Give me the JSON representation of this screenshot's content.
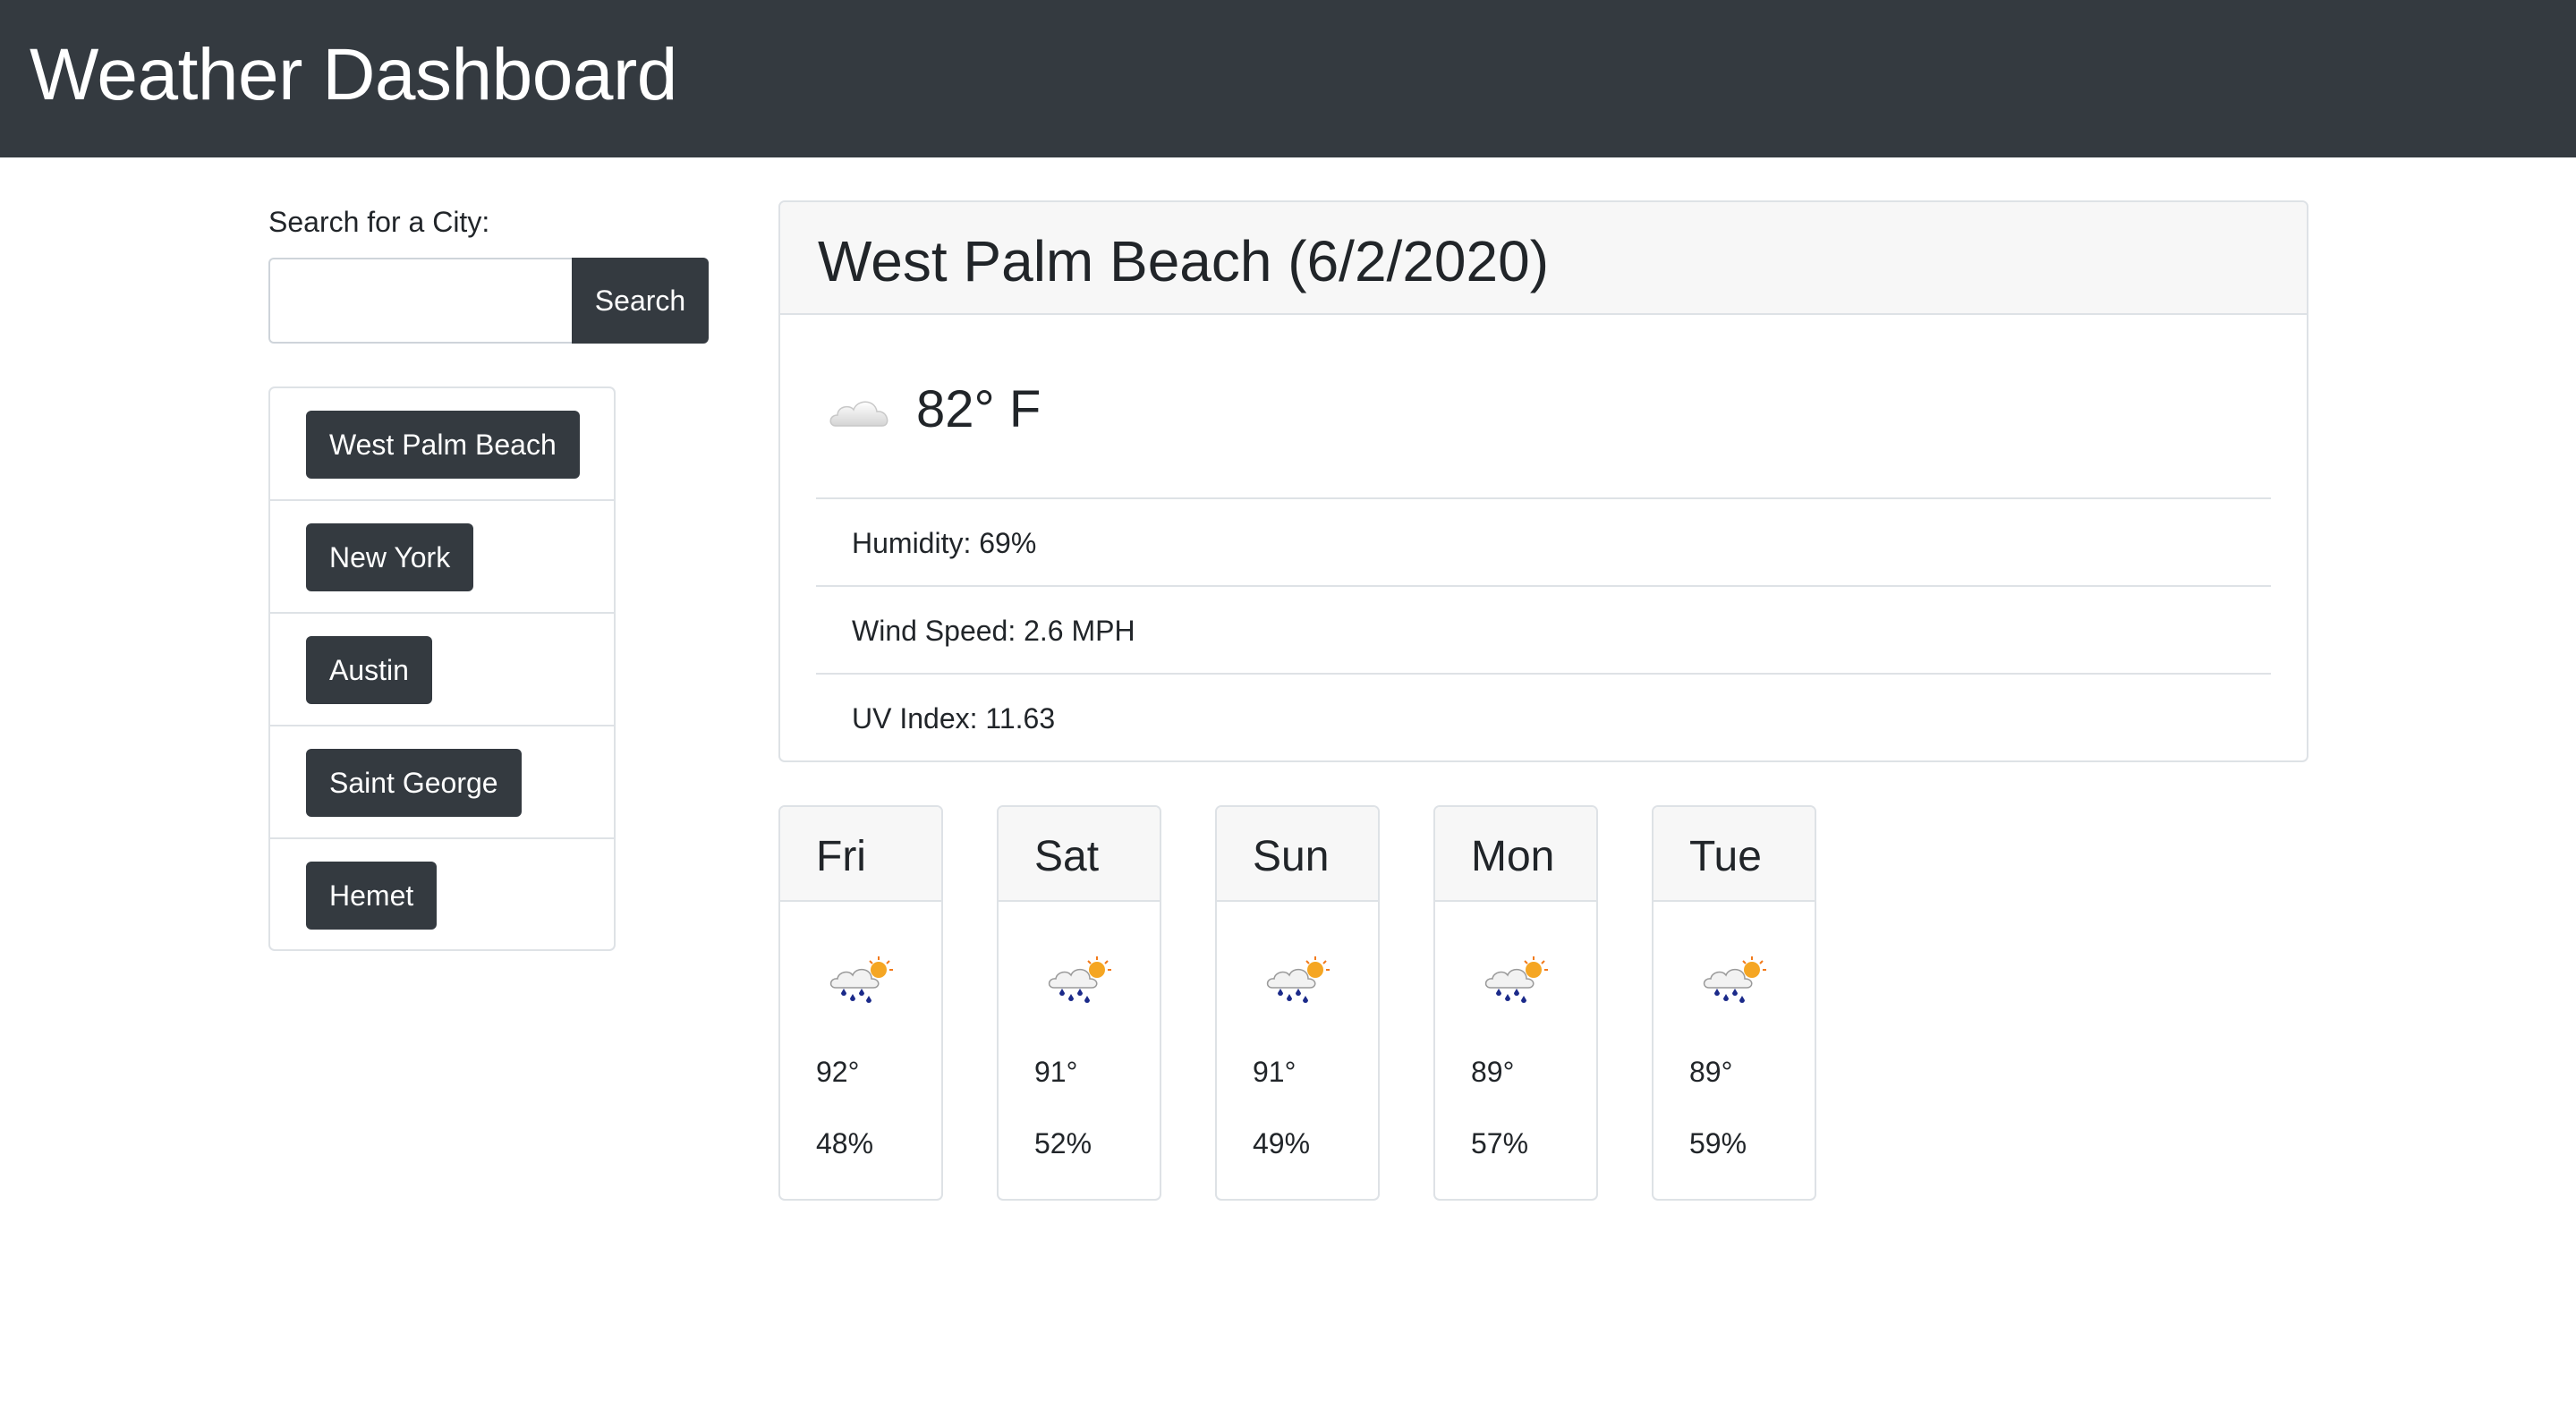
{
  "header": {
    "title": "Weather Dashboard"
  },
  "search": {
    "label": "Search for a City:",
    "input_value": "",
    "placeholder": "",
    "button_label": "Search"
  },
  "history": [
    {
      "label": "West Palm Beach"
    },
    {
      "label": "New York"
    },
    {
      "label": "Austin"
    },
    {
      "label": "Saint George"
    },
    {
      "label": "Hemet"
    }
  ],
  "current": {
    "title": "West Palm Beach (6/2/2020)",
    "icon": "cloud-icon",
    "temp": "82° F",
    "humidity": "Humidity: 69%",
    "wind": "Wind Speed: 2.6 MPH",
    "uv": "UV Index: 11.63"
  },
  "forecast": [
    {
      "day": "Fri",
      "icon": "rain-sun-icon",
      "temp": "92°",
      "humidity": "48%"
    },
    {
      "day": "Sat",
      "icon": "rain-sun-icon",
      "temp": "91°",
      "humidity": "52%"
    },
    {
      "day": "Sun",
      "icon": "rain-sun-icon",
      "temp": "91°",
      "humidity": "49%"
    },
    {
      "day": "Mon",
      "icon": "rain-sun-icon",
      "temp": "89°",
      "humidity": "57%"
    },
    {
      "day": "Tue",
      "icon": "rain-sun-icon",
      "temp": "89°",
      "humidity": "59%"
    }
  ],
  "colors": {
    "navbar": "#343a40",
    "button": "#343a40",
    "card_header": "#f7f7f7",
    "border": "#dee2e6"
  }
}
